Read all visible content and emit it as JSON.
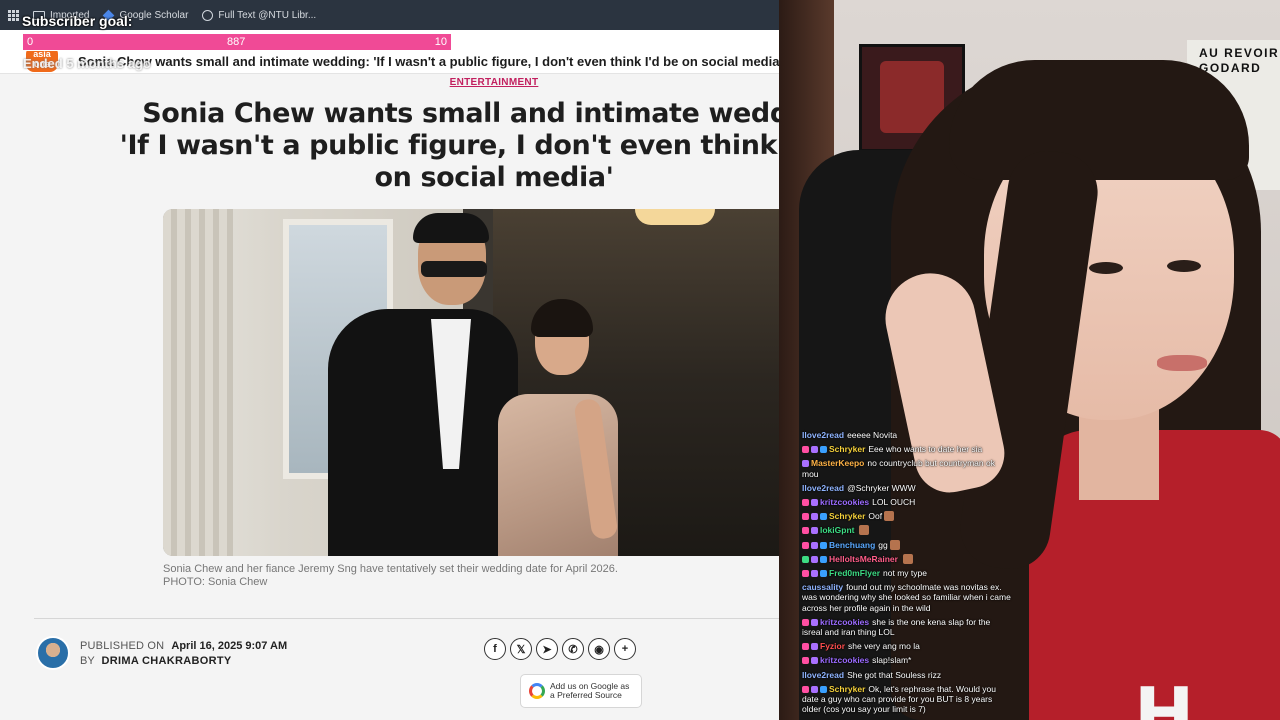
{
  "bookmarks": [
    {
      "label": "Imported",
      "icon": "folder-icon"
    },
    {
      "label": "Google Scholar",
      "icon": "google-scholar-icon"
    },
    {
      "label": "Full Text @NTU Libr...",
      "icon": "globe-icon"
    }
  ],
  "site": {
    "logo_text": "asia one",
    "ticker": "Sonia Chew wants small and intimate wedding: 'If I wasn't a public figure, I don't even think I'd be on social media'"
  },
  "article": {
    "category": "ENTERTAINMENT",
    "headline_lines": [
      "Sonia Chew wants small and intimate wedding:",
      "'If I wasn't a public figure, I don't even think I'd be",
      "on social media'"
    ],
    "caption_lines": [
      "Sonia Chew and her fiance Jeremy Sng have tentatively set their wedding date for April 2026.",
      "PHOTO: Sonia Chew"
    ],
    "published_label": "PUBLISHED ON",
    "published_value": "April 16, 2025 9:07 AM",
    "by_label": "BY",
    "author": "DRIMA CHAKRABORTY",
    "share_icons": [
      {
        "name": "facebook-icon",
        "glyph": "f"
      },
      {
        "name": "x-icon",
        "glyph": "𝕏"
      },
      {
        "name": "telegram-icon",
        "glyph": "➤"
      },
      {
        "name": "whatsapp-icon",
        "glyph": "✆"
      },
      {
        "name": "reddit-icon",
        "glyph": "◉"
      },
      {
        "name": "plus-icon",
        "glyph": "+"
      }
    ],
    "google_pref_lines": [
      "Add us on Google as",
      "a Preferred Source"
    ]
  },
  "overlay": {
    "goal_label": "Subscriber goal:",
    "goal_start": "0",
    "goal_mid": "887",
    "goal_end": "10",
    "goal_ended": "Ended 5 months ago"
  },
  "webcam": {
    "poster_text": [
      "AU REVOIR",
      "GODARD"
    ],
    "shirt_logo": "H"
  },
  "chat": [
    {
      "user": "Ilove2read",
      "color": "#8fb4ff",
      "badges": [],
      "text": "eeeee Novita"
    },
    {
      "user": "Schryker",
      "color": "#f5d13b",
      "badges": [
        "#ff4fa3",
        "#a970ff",
        "#3aa0ff"
      ],
      "text": "Eee who wants to date her sia"
    },
    {
      "user": "MasterKeepo",
      "color": "#ffb347",
      "badges": [
        "#a970ff"
      ],
      "text": "no countryclub but countryman ok mou"
    },
    {
      "user": "Ilove2read",
      "color": "#8fb4ff",
      "badges": [],
      "text": "@Schryker WWW"
    },
    {
      "user": "kritzcookies",
      "color": "#9b6bff",
      "badges": [
        "#ff4fa3",
        "#a970ff"
      ],
      "text": "LOL OUCH"
    },
    {
      "user": "Schryker",
      "color": "#f5d13b",
      "badges": [
        "#ff4fa3",
        "#a970ff",
        "#3aa0ff"
      ],
      "text": "Oof",
      "emote": true
    },
    {
      "user": "lokiGpnt",
      "color": "#3ddc84",
      "badges": [
        "#ff4fa3",
        "#a970ff"
      ],
      "text": "",
      "emote": true
    },
    {
      "user": "Benchuang",
      "color": "#5aa9ff",
      "badges": [
        "#ff4fa3",
        "#a970ff",
        "#3aa0ff"
      ],
      "text": "gg",
      "emote": true
    },
    {
      "user": "HelloItsMeRainer",
      "color": "#ff5e8a",
      "badges": [
        "#3ddc84",
        "#a970ff",
        "#3aa0ff"
      ],
      "text": "",
      "emote": true
    },
    {
      "user": "Fred0mFlyer",
      "color": "#3ddc84",
      "badges": [
        "#ff4fa3",
        "#a970ff",
        "#3aa0ff"
      ],
      "text": "not my type"
    },
    {
      "user": "caussality",
      "color": "#8fb4ff",
      "badges": [],
      "text": "found out my schoolmate was novitas ex. was wondering why she looked so familiar when i came across her profile again in the wild"
    },
    {
      "user": "kritzcookies",
      "color": "#9b6bff",
      "badges": [
        "#ff4fa3",
        "#a970ff"
      ],
      "text": "she is the one kena slap for the isreal and iran thing LOL"
    },
    {
      "user": "Fyzior",
      "color": "#ff4f4f",
      "badges": [
        "#ff4fa3",
        "#a970ff"
      ],
      "text": "she very ang mo la"
    },
    {
      "user": "kritzcookies",
      "color": "#9b6bff",
      "badges": [
        "#ff4fa3",
        "#a970ff"
      ],
      "text": "slap!slam*"
    },
    {
      "user": "Ilove2read",
      "color": "#8fb4ff",
      "badges": [],
      "text": "She got that Souless rizz"
    },
    {
      "user": "Schryker",
      "color": "#f5d13b",
      "badges": [
        "#ff4fa3",
        "#a970ff",
        "#3aa0ff"
      ],
      "text": "Ok, let's rephrase that. Would you date a guy who can provide for you BUT is 8 years older (cos you say your limit is 7)"
    }
  ]
}
